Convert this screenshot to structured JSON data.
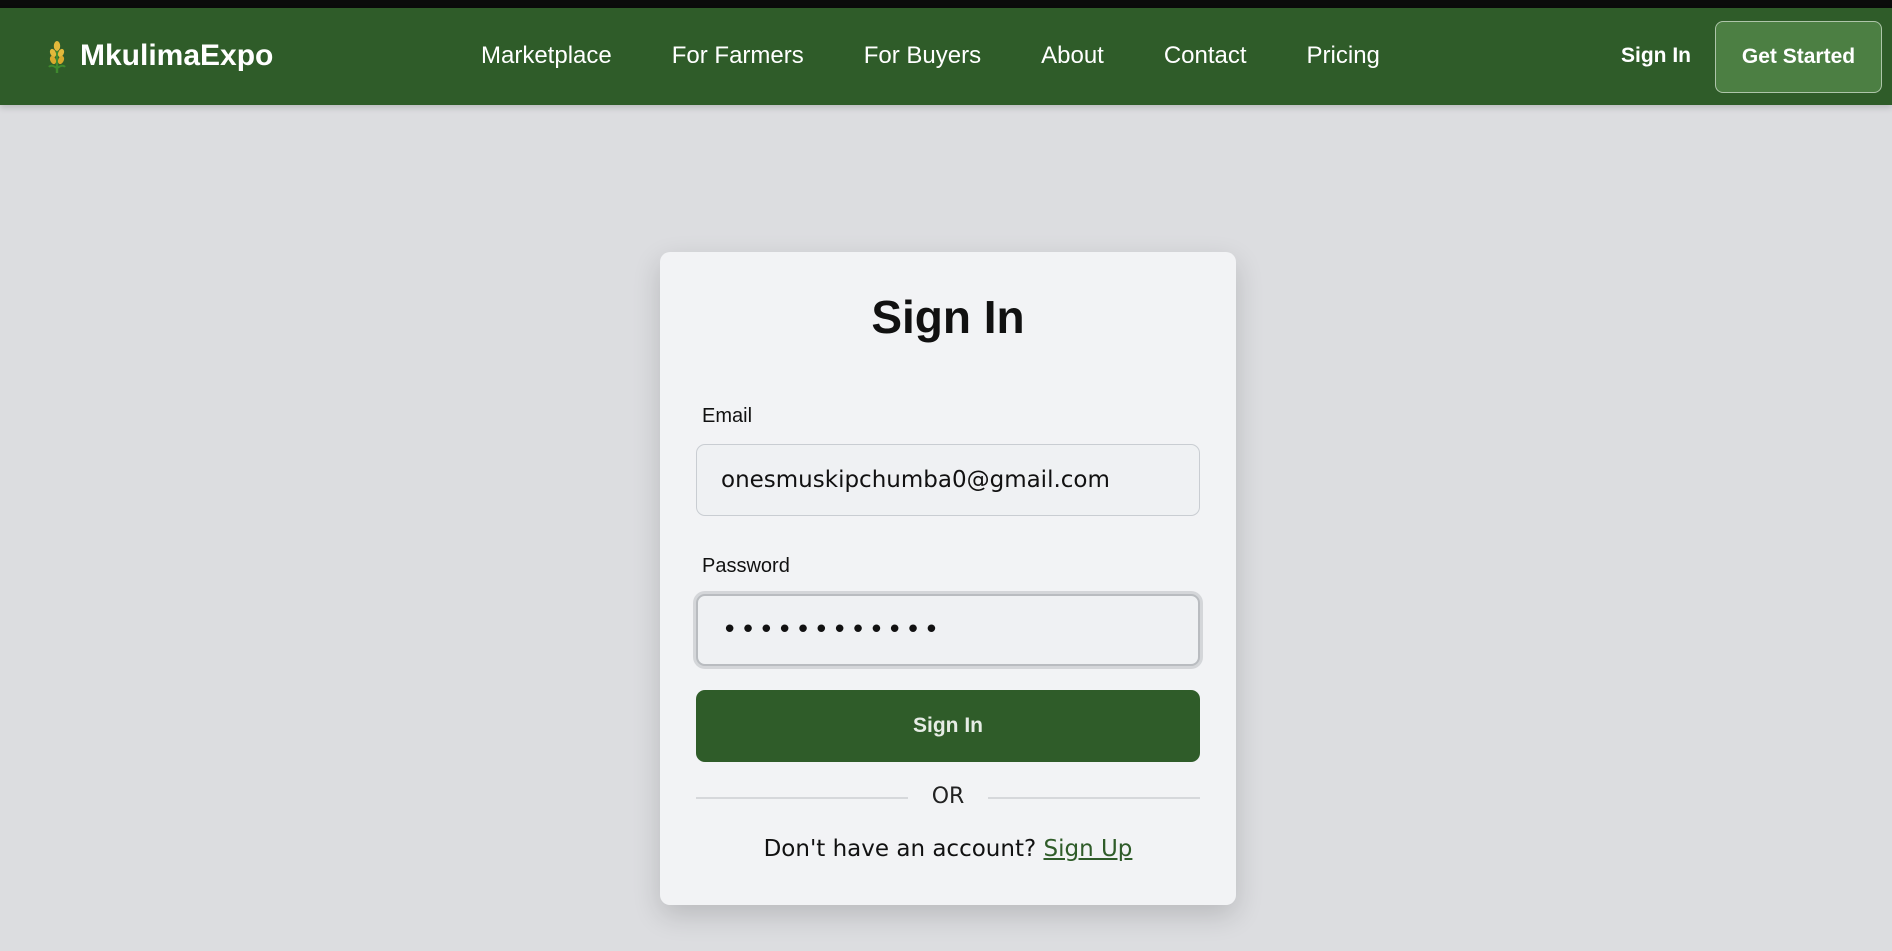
{
  "navbar": {
    "brand": "MkulimaExpo",
    "links": [
      "Marketplace",
      "For Farmers",
      "For Buyers",
      "About",
      "Contact",
      "Pricing"
    ],
    "sign_in": "Sign In",
    "get_started": "Get Started"
  },
  "form": {
    "title": "Sign In",
    "email_label": "Email",
    "email_value": "onesmuskipchumba0@gmail.com",
    "password_label": "Password",
    "password_value": "••••••••••••",
    "submit_label": "Sign In",
    "divider": "OR",
    "signup_prompt": "Don't have an account?",
    "signup_link": "Sign Up"
  },
  "icons": {
    "brand": "wheat-icon"
  },
  "colors": {
    "primary_green": "#2f5c29",
    "page_background": "#dcdde0",
    "card_background": "#f2f3f5",
    "get_started_bg": "#4c7f43"
  }
}
